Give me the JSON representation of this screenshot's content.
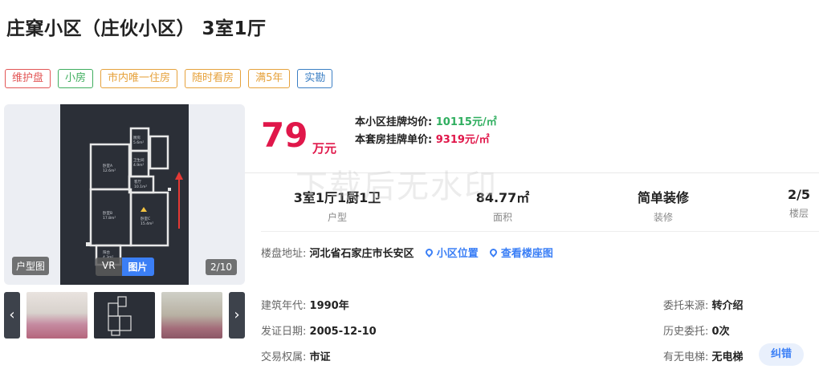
{
  "listing": {
    "title": "庄窠小区（庄伙小区） 3室1厅",
    "tags": [
      {
        "label": "维护盘",
        "color": "#e25555"
      },
      {
        "label": "小房",
        "color": "#3fae5e"
      },
      {
        "label": "市内唯一住房",
        "color": "#e6a23c"
      },
      {
        "label": "随时看房",
        "color": "#e6a23c"
      },
      {
        "label": "满5年",
        "color": "#e6a23c"
      },
      {
        "label": "实勘",
        "color": "#3b7fc4"
      }
    ]
  },
  "gallery": {
    "type_badge": "户型图",
    "vr_label": "VR",
    "pic_label": "图片",
    "counter": "2/10",
    "plan_rooms": [
      {
        "name": "厨房",
        "area": "5.6m²"
      },
      {
        "name": "卫生间",
        "area": "4.9m²"
      },
      {
        "name": "卧室A",
        "area": "12.6m²"
      },
      {
        "name": "客厅",
        "area": "10.1m²"
      },
      {
        "name": "卧室B",
        "area": "17.8m²"
      },
      {
        "name": "卧室C",
        "area": "15.4m²"
      },
      {
        "name": "阳台",
        "area": "4.3m²"
      }
    ],
    "thumbnails": [
      "living-room-photo",
      "floorplan-photo",
      "bedroom-photo"
    ],
    "prev_icon": "chevron-left-icon",
    "next_icon": "chevron-right-icon"
  },
  "price": {
    "total": "79",
    "unit": "万元",
    "community_avg_label": "本小区挂牌均价:",
    "community_avg_value": "10115元/㎡",
    "unit_price_label": "本套房挂牌单价:",
    "unit_price_value": "9319元/㎡"
  },
  "stats": [
    {
      "value": "3室1厅1厨1卫",
      "label": "户型"
    },
    {
      "value": "84.77㎡",
      "label": "面积"
    },
    {
      "value": "简单装修",
      "label": "装修"
    },
    {
      "value": "2/5",
      "label": "楼层"
    }
  ],
  "address": {
    "label": "楼盘地址:",
    "value": "河北省石家庄市长安区",
    "link1": "小区位置",
    "link2": "查看楼座图"
  },
  "details": {
    "build_year_label": "建筑年代:",
    "build_year_value": "1990年",
    "cert_date_label": "发证日期:",
    "cert_date_value": "2005-12-10",
    "ownership_label": "交易权属:",
    "ownership_value": "市证",
    "source_label": "委托来源:",
    "source_value": "转介绍",
    "history_label": "历史委托:",
    "history_value": "0次",
    "elevator_label": "有无电梯:",
    "elevator_value": "无电梯",
    "correct_button": "纠错"
  },
  "watermark": "下载后无水印",
  "colors": {
    "price_red": "#e0174a",
    "avg_green": "#2fae5f",
    "link_blue": "#3b7ff6"
  }
}
